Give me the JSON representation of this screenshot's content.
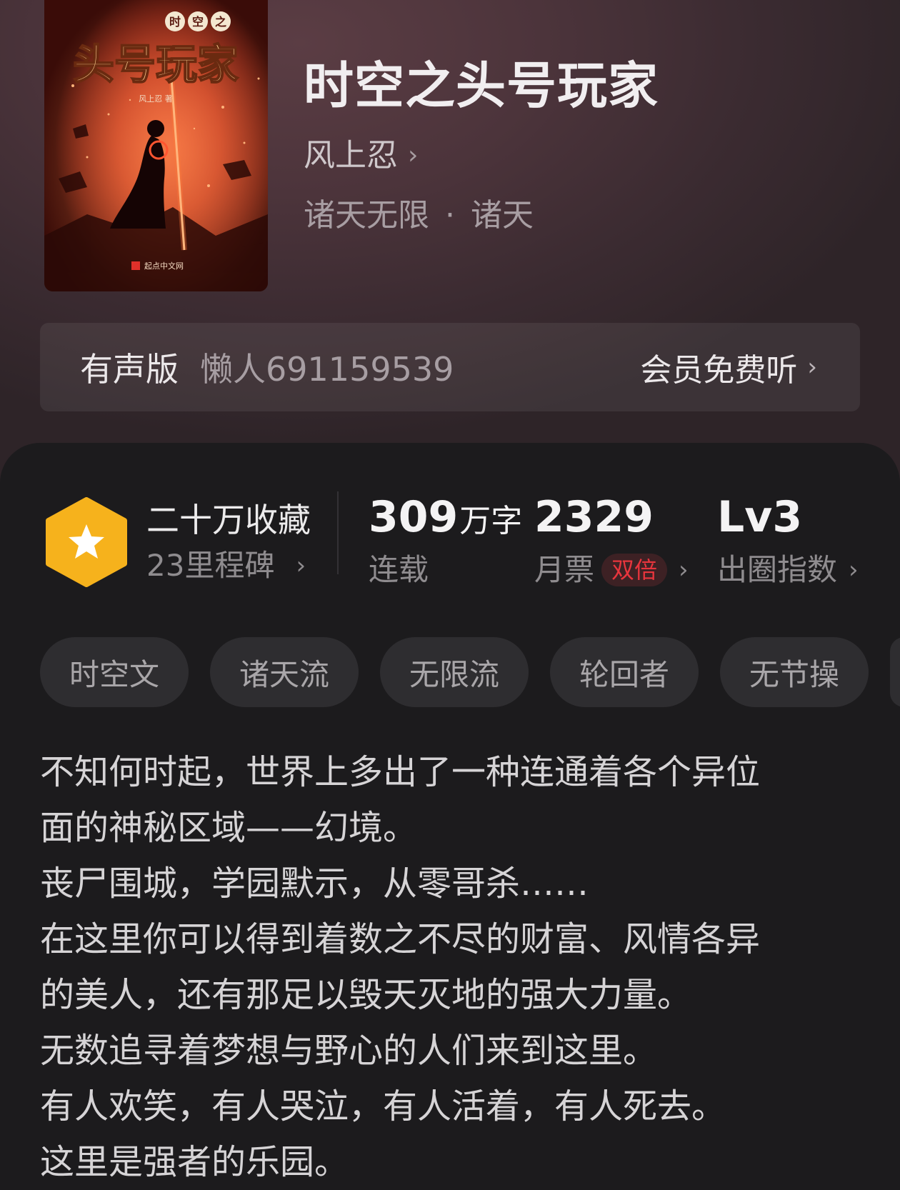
{
  "book": {
    "title": "时空之头号玩家",
    "author": "风上忍",
    "genre": "诸天无限",
    "subgenre": "诸天",
    "genre_separator": "·"
  },
  "cover": {
    "series_chars": [
      "时",
      "空",
      "之"
    ],
    "title_text": "头号玩家",
    "author_text": "风上忍 著",
    "publisher": "起点中文网"
  },
  "audio": {
    "label": "有声版",
    "narrator": "懒人691159539",
    "cta": "会员免费听"
  },
  "stats": {
    "collection": {
      "main": "二十万收藏",
      "sub": "23里程碑"
    },
    "words": {
      "value": "309",
      "unit": "万字",
      "label": "连载"
    },
    "monthly_ticket": {
      "value": "2329",
      "label": "月票",
      "badge": "双倍"
    },
    "influence": {
      "value": "Lv3",
      "label": "出圈指数"
    }
  },
  "tags": [
    "时空文",
    "诸天流",
    "无限流",
    "轮回者",
    "无节操"
  ],
  "synopsis": [
    "不知何时起，世界上多出了一种连通着各个异位",
    "面的神秘区域——幻境。",
    "丧尸围城，学园默示，从零哥杀……",
    "在这里你可以得到着数之不尽的财富、风情各异",
    "的美人，还有那足以毁天灭地的强大力量。",
    "无数追寻着梦想与野心的人们来到这里。",
    "有人欢笑，有人哭泣，有人活着，有人死去。",
    "这里是强者的乐园。"
  ],
  "colors": {
    "badge_gold": "#f6b21c",
    "double_badge_red": "#e8353d",
    "panel_bg": "#1c1b1d"
  },
  "icons": {
    "chevron": "›",
    "star": "star-icon"
  }
}
